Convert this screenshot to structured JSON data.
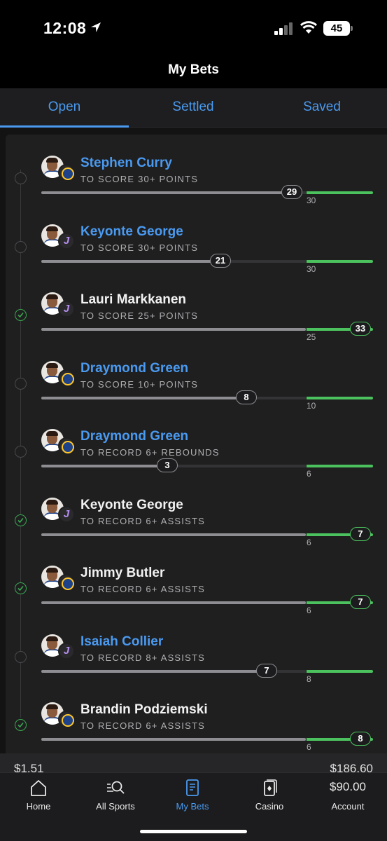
{
  "status_bar": {
    "time": "12:08",
    "battery": "45"
  },
  "header": {
    "title": "My Bets"
  },
  "tabs": [
    {
      "label": "Open",
      "active": true
    },
    {
      "label": "Settled",
      "active": false
    },
    {
      "label": "Saved",
      "active": false
    }
  ],
  "legs": [
    {
      "player": "Stephen Curry",
      "market": "TO SCORE 30+ POINTS",
      "team": "gsw",
      "status": "live",
      "current": 29,
      "target": 30,
      "progress": 0.97
    },
    {
      "player": "Keyonte George",
      "market": "TO SCORE 30+ POINTS",
      "team": "uta",
      "status": "live",
      "current": 21,
      "target": 30,
      "progress": 0.7
    },
    {
      "player": "Lauri Markkanen",
      "market": "TO SCORE 25+ POINTS",
      "team": "uta",
      "status": "won",
      "current": 33,
      "target": 25,
      "progress": 1.0
    },
    {
      "player": "Draymond Green",
      "market": "TO SCORE 10+ POINTS",
      "team": "gsw",
      "status": "live",
      "current": 8,
      "target": 10,
      "progress": 0.8
    },
    {
      "player": "Draymond Green",
      "market": "TO RECORD 6+ REBOUNDS",
      "team": "gsw",
      "status": "live",
      "current": 3,
      "target": 6,
      "progress": 0.5
    },
    {
      "player": "Keyonte George",
      "market": "TO RECORD 6+ ASSISTS",
      "team": "uta",
      "status": "won",
      "current": 7,
      "target": 6,
      "progress": 1.0
    },
    {
      "player": "Jimmy Butler",
      "market": "TO RECORD 6+ ASSISTS",
      "team": "gsw",
      "status": "won",
      "current": 7,
      "target": 6,
      "progress": 1.0
    },
    {
      "player": "Isaiah Collier",
      "market": "TO RECORD 8+ ASSISTS",
      "team": "uta",
      "status": "live",
      "current": 7,
      "target": 8,
      "progress": 0.875
    },
    {
      "player": "Brandin Podziemski",
      "market": "TO RECORD 6+ ASSISTS",
      "team": "gsw",
      "status": "won",
      "current": 8,
      "target": 6,
      "progress": 1.0
    }
  ],
  "footer": {
    "stake": "$1.51",
    "payout": "$186.60"
  },
  "tabbar": {
    "items": [
      {
        "label": "Home",
        "icon": "home-icon"
      },
      {
        "label": "All Sports",
        "icon": "search-icon"
      },
      {
        "label": "My Bets",
        "icon": "bet-slip-icon",
        "active": true
      },
      {
        "label": "Casino",
        "icon": "cards-icon"
      },
      {
        "label": "Account",
        "icon": "account-icon"
      }
    ],
    "account_balance": "$90.00"
  },
  "colors": {
    "accent": "#4a9af0",
    "success": "#4cc25e",
    "background": "#1f1f20"
  }
}
